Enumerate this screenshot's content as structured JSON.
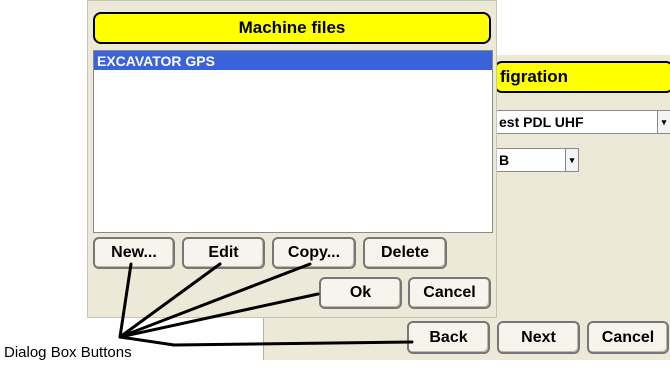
{
  "back_dialog": {
    "title": "figration",
    "radio_combo": "est PDL UHF",
    "channel_combo": "B",
    "buttons": {
      "back": "Back",
      "next": "Next",
      "cancel": "Cancel"
    }
  },
  "front_dialog": {
    "title": "Machine files",
    "list_items": [
      "EXCAVATOR GPS"
    ],
    "buttons": {
      "new": "New...",
      "edit": "Edit",
      "copy": "Copy...",
      "delete": "Delete",
      "ok": "Ok",
      "cancel": "Cancel"
    }
  },
  "annotation": {
    "label": "Dialog Box Buttons"
  },
  "colors": {
    "title_bar": "#ffff00",
    "selection": "#3a63d8",
    "dialog_bg": "#ece9d8"
  },
  "icons": {
    "combo_arrow": "dropdown-arrow-icon"
  }
}
